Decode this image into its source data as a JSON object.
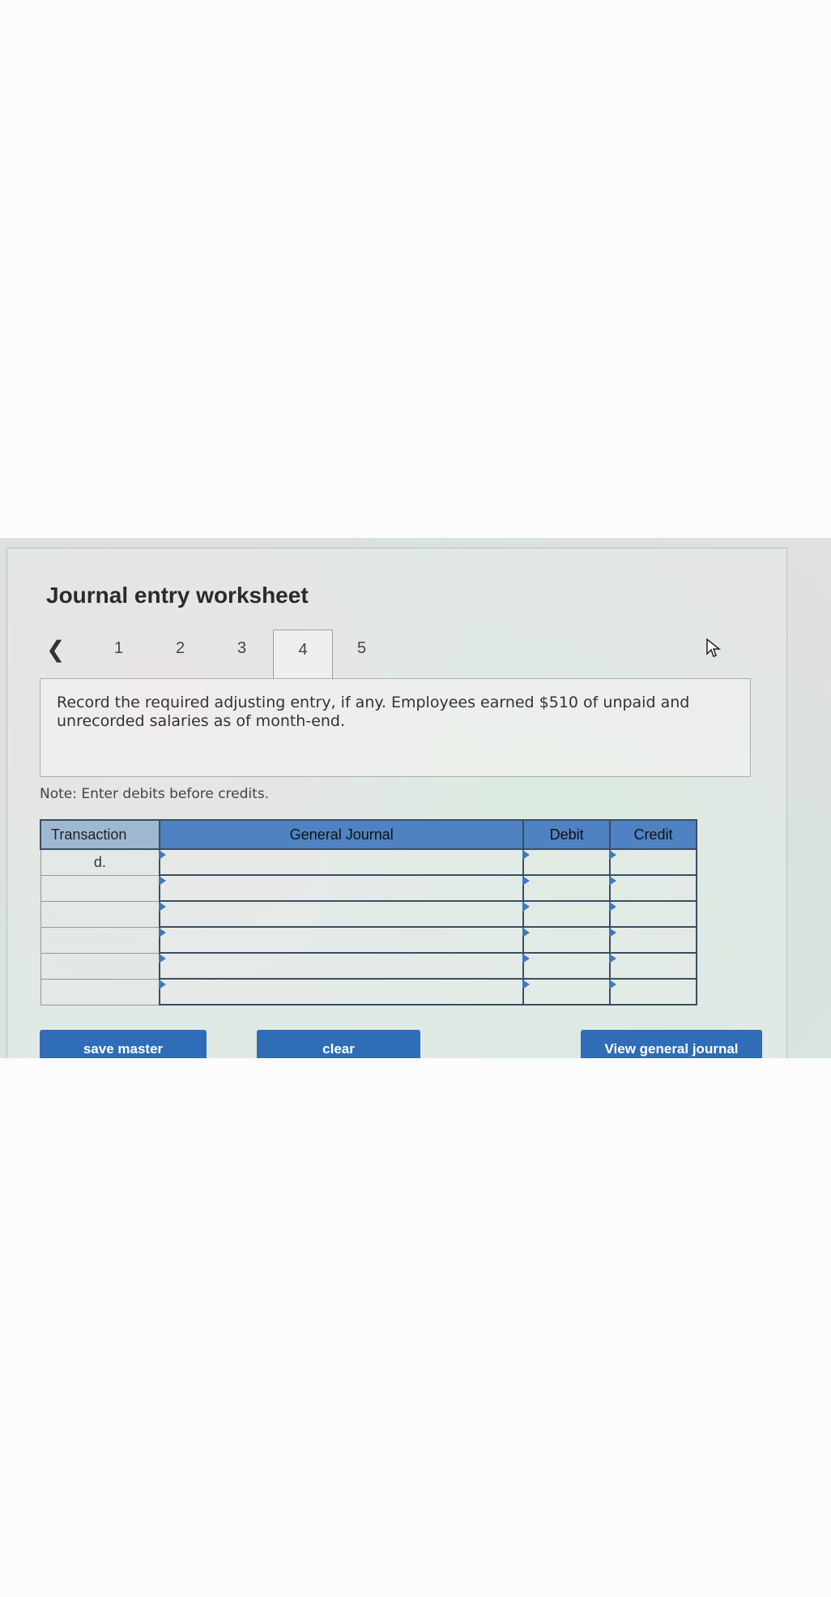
{
  "title": "Journal entry worksheet",
  "tabs": {
    "prev_icon": "chevron-left-icon",
    "items": [
      "1",
      "2",
      "3",
      "4",
      "5"
    ],
    "active": "4"
  },
  "prompt": "Record the required adjusting entry, if any. Employees earned $510 of unpaid and unrecorded salaries as of month-end.",
  "note": "Note: Enter debits before credits.",
  "table": {
    "headers": {
      "transaction": "Transaction",
      "general_journal": "General Journal",
      "debit": "Debit",
      "credit": "Credit"
    },
    "rows": [
      {
        "transaction": "d.",
        "account": "",
        "debit": "",
        "credit": ""
      },
      {
        "transaction": "",
        "account": "",
        "debit": "",
        "credit": ""
      },
      {
        "transaction": "",
        "account": "",
        "debit": "",
        "credit": ""
      },
      {
        "transaction": "",
        "account": "",
        "debit": "",
        "credit": ""
      },
      {
        "transaction": "",
        "account": "",
        "debit": "",
        "credit": ""
      },
      {
        "transaction": "",
        "account": "",
        "debit": "",
        "credit": ""
      }
    ]
  },
  "buttons": {
    "save": "save master",
    "clear": "clear",
    "view": "View general journal"
  },
  "colors": {
    "button": "#2f6db6",
    "header": "#4e82c2"
  }
}
